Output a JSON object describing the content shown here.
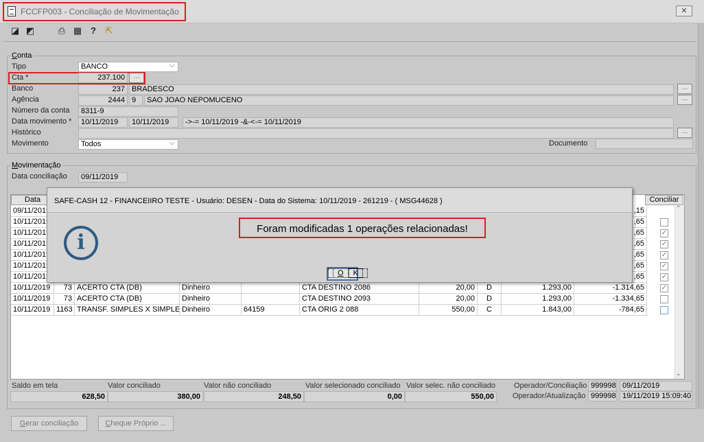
{
  "window": {
    "title": "FCCFP003 - Conciliação de Movimentação",
    "close": "✕"
  },
  "toolbar": {
    "icons": [
      "cursor-icon",
      "copy-icon",
      "print-icon",
      "grid-icon",
      "help-icon",
      "exit-icon"
    ],
    "glyphs": [
      "◪",
      "◩",
      "⎙",
      "▦",
      "?",
      "⇱"
    ]
  },
  "conta": {
    "group_label_u": "C",
    "group_label_rest": "onta",
    "tipo_label": "Tipo",
    "tipo_value": "BANCO",
    "cta_label": "Cta *",
    "cta_value": "237.100",
    "banco_label": "Banco",
    "banco_code": "237",
    "banco_name": "BRADESCO",
    "agencia_label": "Agência",
    "agencia_code": "2444",
    "agencia_digit": "9",
    "agencia_name": "SAO JOAO NEPOMUCENO",
    "numero_label": "Número da conta",
    "numero_value": "8311-9",
    "data_mov_label": "Data movimento *",
    "data_mov_from": "10/11/2019",
    "data_mov_to": "10/11/2019",
    "data_mov_expr": "->-= 10/11/2019 -&-<-= 10/11/2019",
    "historico_label": "Histórico",
    "historico_value": "",
    "movimento_label": "Movimento",
    "movimento_value": "Todos",
    "documento_label": "Documento",
    "documento_value": ""
  },
  "movimentacao": {
    "group_label_u": "M",
    "group_label_rest": "ovimentação",
    "data_conc_label": "Data conciliação",
    "data_conc_value": "09/11/2019"
  },
  "grid": {
    "header_data": "Data",
    "header_conciliar": "Conciliar",
    "rows": [
      {
        "data": "09/11/2019",
        "c2": "",
        "c3": "",
        "c4": "",
        "c5": "",
        "c6": "",
        "c7": "",
        "c8": "",
        "c9": "",
        "c10": ",15",
        "check": "none"
      },
      {
        "data": "10/11/2019",
        "c2": "",
        "c3": "",
        "c4": "",
        "c5": "",
        "c6": "",
        "c7": "",
        "c8": "",
        "c9": "",
        "c10": ",65",
        "check": "empty"
      },
      {
        "data": "10/11/2019",
        "c2": "",
        "c3": "",
        "c4": "",
        "c5": "",
        "c6": "",
        "c7": "",
        "c8": "",
        "c9": "",
        "c10": ",65",
        "check": "checked"
      },
      {
        "data": "10/11/2019",
        "c2": "",
        "c3": "",
        "c4": "",
        "c5": "",
        "c6": "",
        "c7": "",
        "c8": "",
        "c9": "",
        "c10": ",65",
        "check": "checked"
      },
      {
        "data": "10/11/2019",
        "c2": "",
        "c3": "",
        "c4": "",
        "c5": "",
        "c6": "",
        "c7": "",
        "c8": "",
        "c9": "",
        "c10": ",65",
        "check": "checked"
      },
      {
        "data": "10/11/2019",
        "c2": "",
        "c3": "",
        "c4": "",
        "c5": "",
        "c6": "",
        "c7": "",
        "c8": "",
        "c9": "",
        "c10": ",65",
        "check": "checked"
      },
      {
        "data": "10/11/2019",
        "c2": "",
        "c3": "",
        "c4": "",
        "c5": "",
        "c6": "",
        "c7": "",
        "c8": "",
        "c9": "",
        "c10": ",65",
        "check": "checked"
      },
      {
        "data": "10/11/2019",
        "c2": "73",
        "c3": "ACERTO CTA (DB)",
        "c4": "Dinheiro",
        "c5": "",
        "c6": "CTA DESTINO  2086",
        "c7": "20,00",
        "c8": "D",
        "c9": "1.293,00",
        "c10": "-1.314,65",
        "check": "checked"
      },
      {
        "data": "10/11/2019",
        "c2": "73",
        "c3": "ACERTO CTA (DB)",
        "c4": "Dinheiro",
        "c5": "",
        "c6": "CTA DESTINO  2093",
        "c7": "20,00",
        "c8": "D",
        "c9": "1.293,00",
        "c10": "-1.334,65",
        "check": "empty"
      },
      {
        "data": "10/11/2019",
        "c2": "1163",
        "c3": "TRANSF. SIMPLES X SIMPLES",
        "c4": "Dinheiro",
        "c5": "64159",
        "c6": "CTA ORIG  2 088",
        "c7": "550,00",
        "c8": "C",
        "c9": "1.843,00",
        "c10": "-784,65",
        "check": "focused"
      }
    ]
  },
  "dialog": {
    "title": "SAFE-CASH 12 - FINANCEIIRO TESTE - Usuário: DESEN - Data do Sistema: 10/11/2019 - 261219 - ( MSG44628 )",
    "message": "Foram modificadas 1 operações relacionadas!",
    "icon": "i",
    "ok_u": "O",
    "ok_rest": "K"
  },
  "totals": {
    "saldo_label": "Saldo em tela",
    "saldo_value": "628,50",
    "conciliado_label": "Valor conciliado",
    "conciliado_value": "380,00",
    "nao_conciliado_label": "Valor não conciliado",
    "nao_conciliado_value": "248,50",
    "selecionado_label": "Valor selecionado conciliado",
    "selecionado_value": "0,00",
    "selec_nao_label": "Valor selec. não conciliado",
    "selec_nao_value": "550,00",
    "op_conc_label": "Operador/Conciliação",
    "op_conc_code": "999998",
    "op_conc_date": "09/11/2019",
    "op_atual_label": "Operador/Atualização",
    "op_atual_code": "999998",
    "op_atual_date": "19/11/2019 15:09:40"
  },
  "buttons": {
    "gerar_u": "G",
    "gerar_rest": "erar conciliação",
    "cheque_u": "C",
    "cheque_rest": "heque Próprio ..."
  }
}
